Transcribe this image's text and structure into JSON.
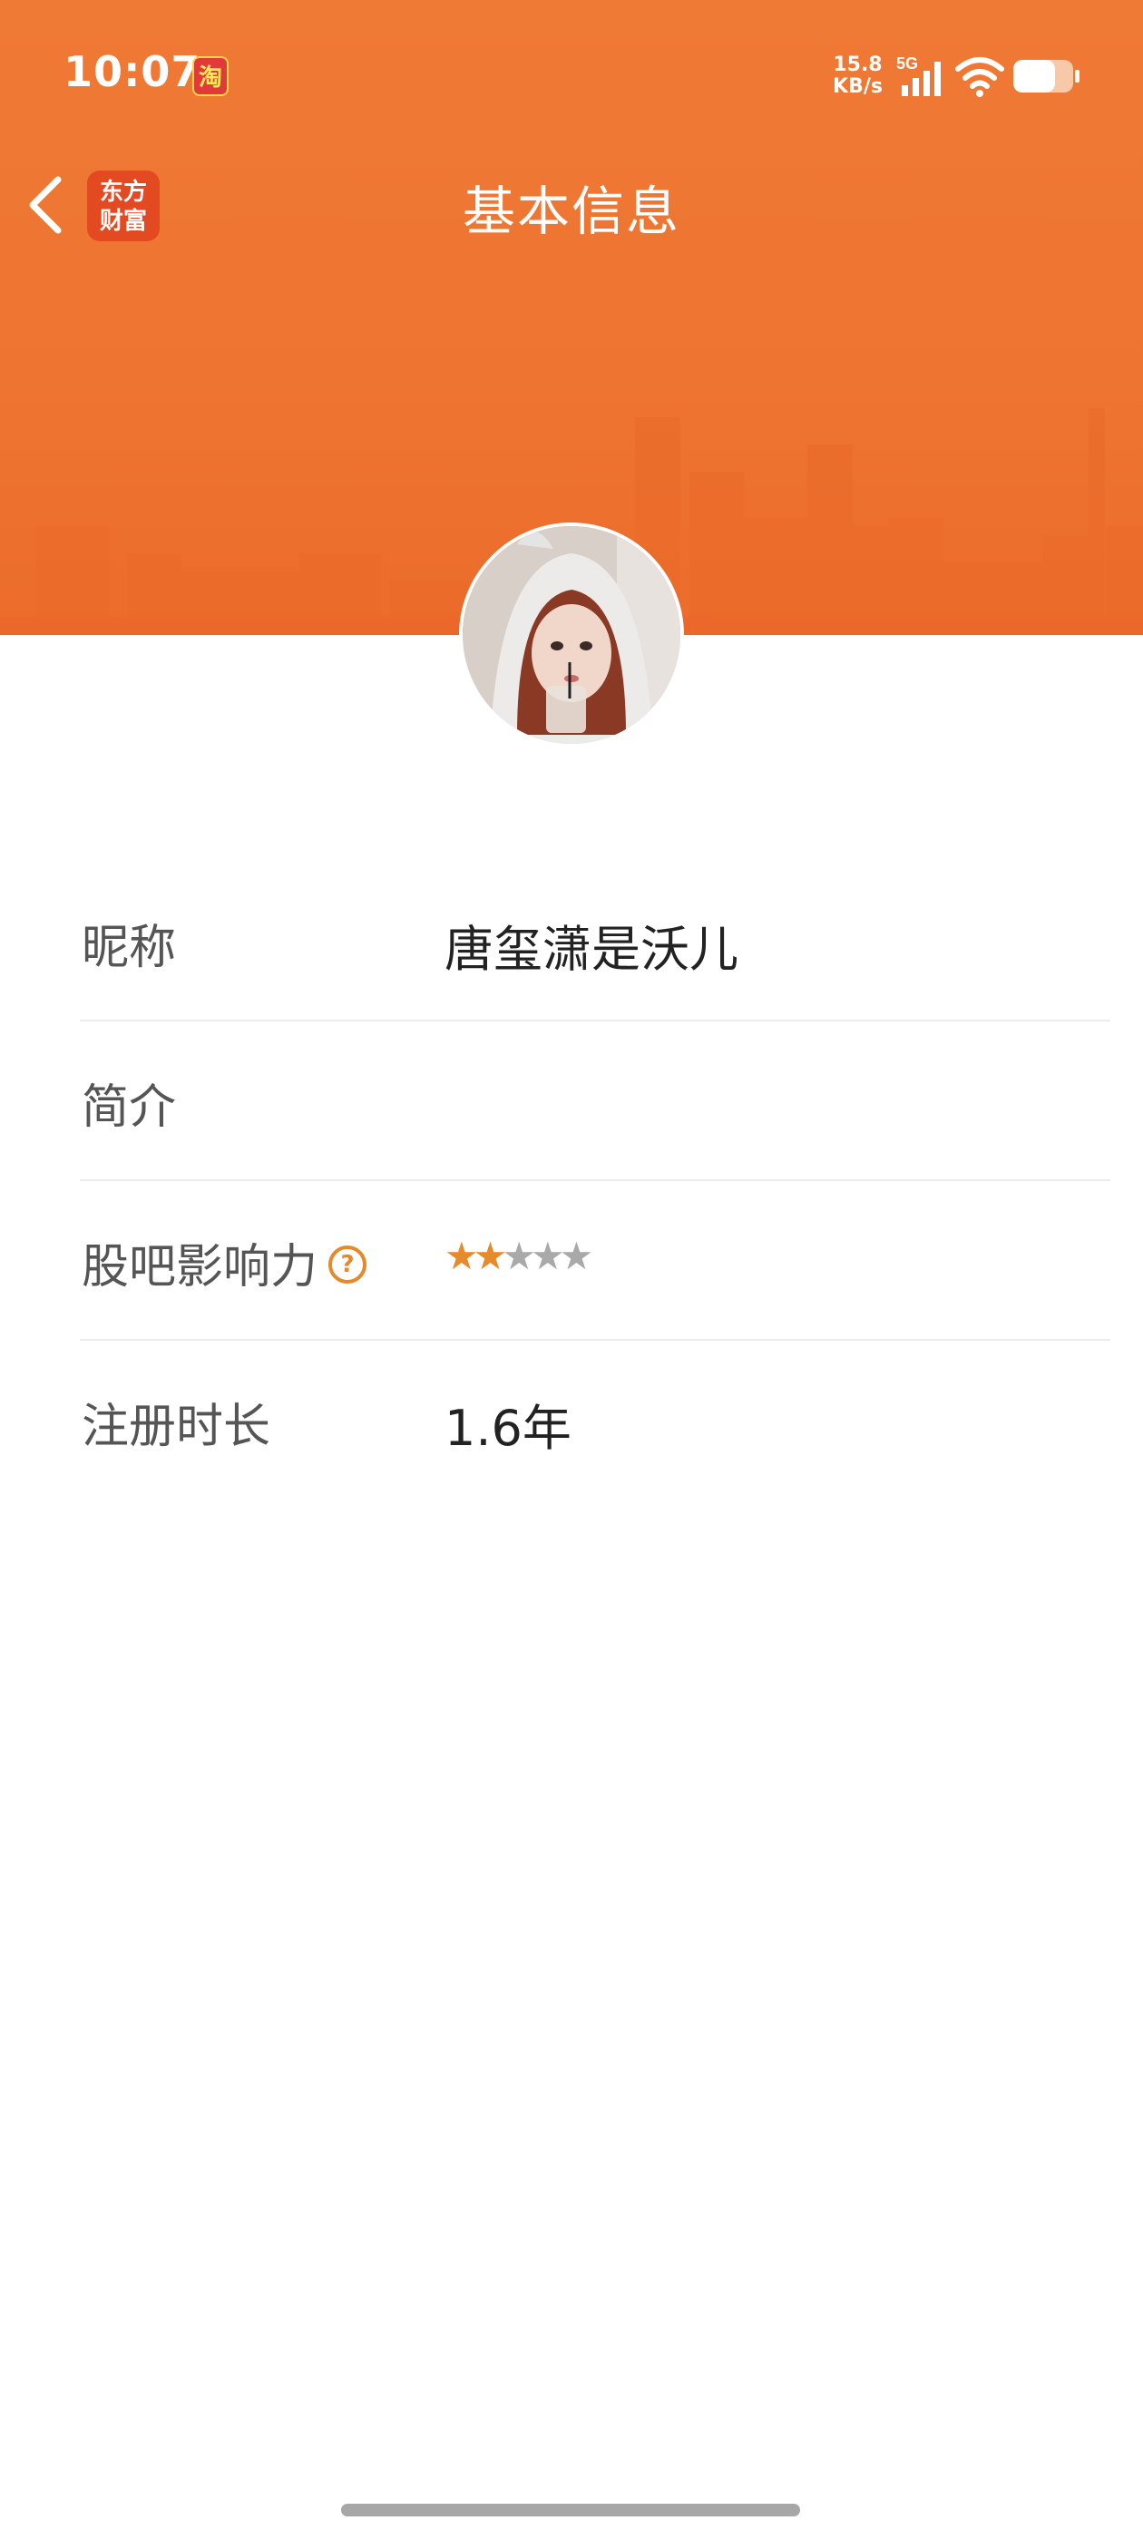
{
  "status_bar": {
    "time": "10:07",
    "taobao_icon": "淘",
    "net_speed_value": "15.8",
    "net_speed_unit": "KB/s",
    "network": "5G"
  },
  "nav": {
    "app_badge_line1": "东方",
    "app_badge_line2": "财富",
    "title": "基本信息"
  },
  "profile": {
    "rows": [
      {
        "label": "昵称",
        "value": "唐玺潇是沃儿"
      },
      {
        "label": "简介",
        "value": ""
      },
      {
        "label": "股吧影响力",
        "help_icon": "?",
        "rating": 2,
        "rating_max": 5
      },
      {
        "label": "注册时长",
        "value": "1.6年"
      }
    ]
  },
  "colors": {
    "header_orange": "#ee7431",
    "star_active": "#e68a2e",
    "star_inactive": "#a9a9a9"
  },
  "icons": {
    "back": "chevron-left-icon",
    "help": "question-circle-icon",
    "wifi": "wifi-icon",
    "battery": "battery-icon",
    "signal": "signal-5g-icon"
  }
}
